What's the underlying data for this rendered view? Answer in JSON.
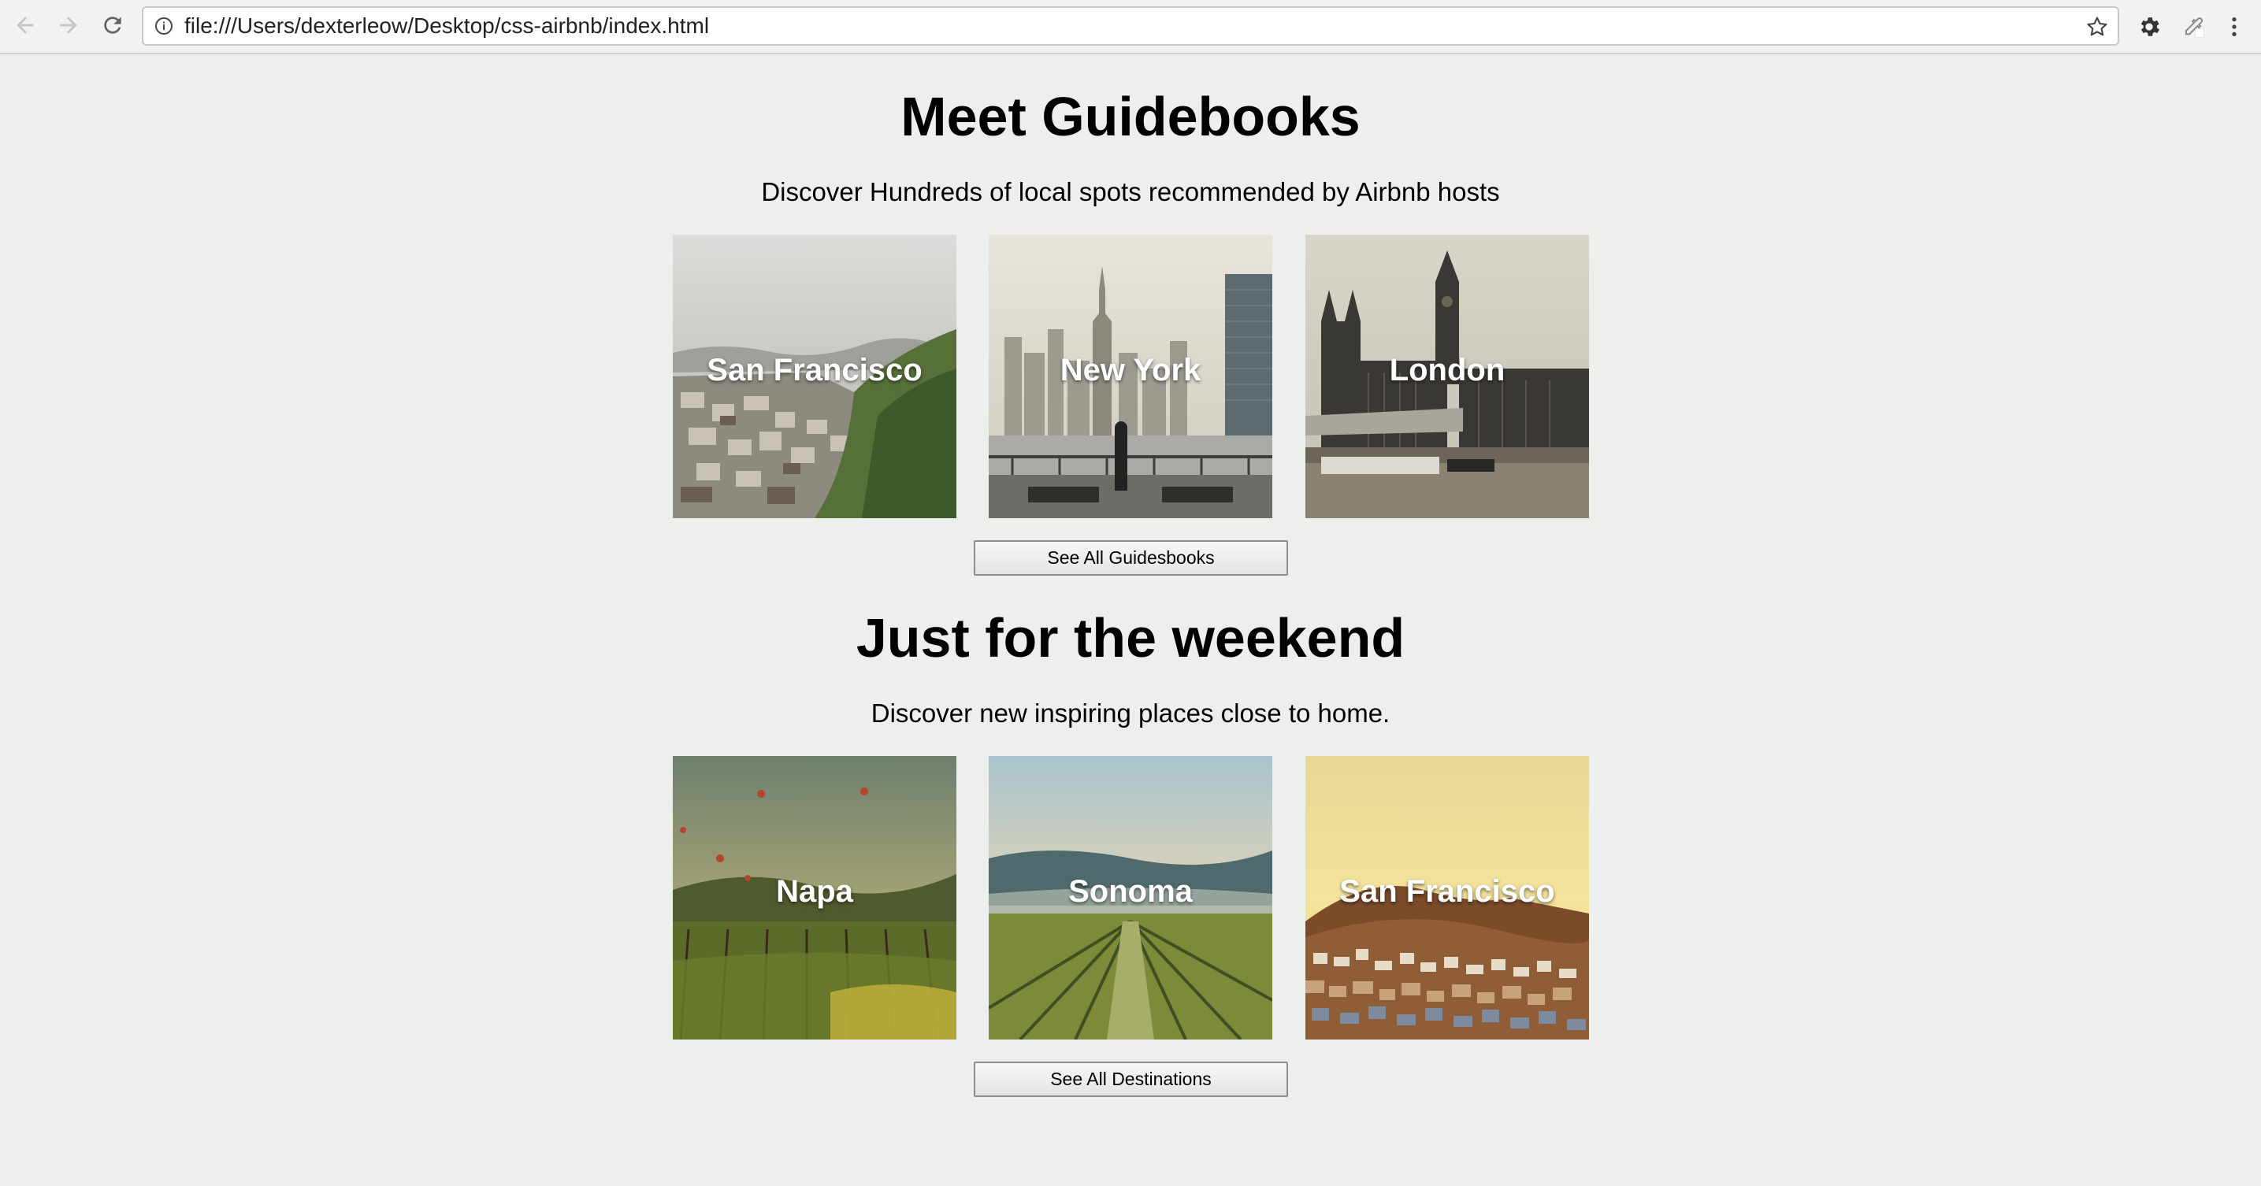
{
  "browser": {
    "url": "file:///Users/dexterleow/Desktop/css-airbnb/index.html"
  },
  "guidebooks": {
    "title": "Meet Guidebooks",
    "subtitle": "Discover Hundreds of local spots recommended by Airbnb hosts",
    "cards": [
      {
        "label": "San Francisco"
      },
      {
        "label": "New York"
      },
      {
        "label": "London"
      }
    ],
    "button_label": "See All Guidesbooks"
  },
  "weekend": {
    "title": "Just for the weekend",
    "subtitle": "Discover new inspiring places close to home.",
    "cards": [
      {
        "label": "Napa"
      },
      {
        "label": "Sonoma"
      },
      {
        "label": "San Francisco"
      }
    ],
    "button_label": "See All Destinations"
  }
}
